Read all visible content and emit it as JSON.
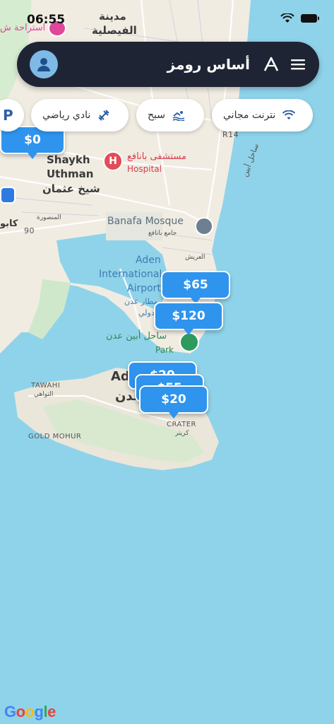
{
  "status": {
    "time": "06:55"
  },
  "header": {
    "title": "أساس رومز"
  },
  "filters": [
    {
      "label": "نترنت مجاني",
      "icon": "wifi-icon"
    },
    {
      "label": "سبح",
      "icon": "swimming-icon"
    },
    {
      "label": "نادي رياضي",
      "icon": "fitness-icon"
    },
    {
      "label": "P",
      "icon": "parking-icon"
    }
  ],
  "markers": [
    {
      "price": "$0"
    },
    {
      "price": "$65"
    },
    {
      "price": "$120"
    },
    {
      "price": "$20"
    },
    {
      "price": "$55"
    },
    {
      "price": "$20"
    }
  ],
  "map_labels": {
    "faisaliya_1": "مدينة",
    "faisaliya_2": "الفيصلية",
    "rest_house": "استراحة ش",
    "shaykh_en_1": "Shaykh",
    "shaykh_en_2": "Uthman",
    "shaykh_ar": "شيخ عثمان",
    "hospital_ar": "مستشفى بانافع",
    "hospital_en": "Hospital",
    "mansoura": "المنصورة",
    "kabo": "كابو",
    "road_90": "90",
    "road_r14": "R14",
    "coast_road": "ساحل أبين",
    "mosque_en": "Banafa Mosque",
    "mosque_ar": "جامع بانافع",
    "arish": "العريش",
    "airport_1": "Aden",
    "airport_2": "International",
    "airport_3": "Airport",
    "airport_ar_1": "مطار عدن",
    "airport_ar_2": "الدولي",
    "park_ar": "ساحل أبين عدن",
    "park_en": "Park",
    "aden_en": "Ad",
    "aden_ar": "عدن",
    "tawahi_en": "TAWAHI",
    "tawahi_ar": "التواهي",
    "gold_mohur": "GOLD MOHUR",
    "crater_en": "CRATER",
    "crater_ar": "كريتر"
  },
  "attribution": "Google",
  "colors": {
    "sea": "#8fd3ea",
    "land": "#f1ece2",
    "header": "#1f2435",
    "marker": "#2f94ee"
  }
}
